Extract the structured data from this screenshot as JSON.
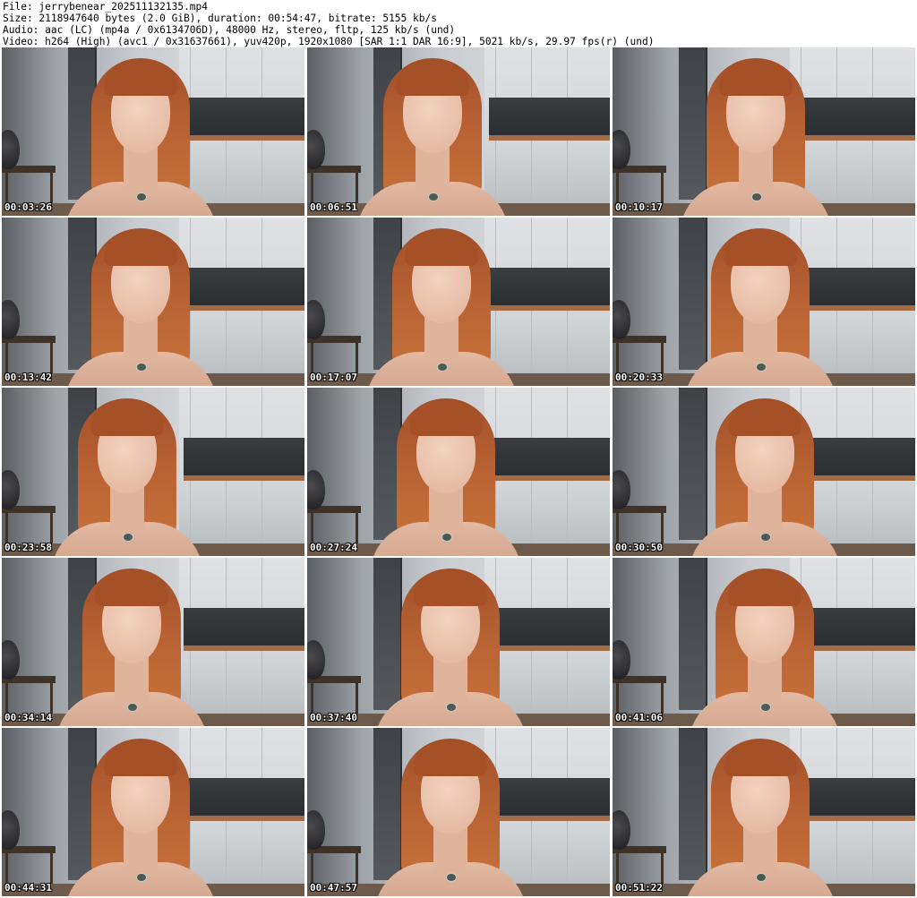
{
  "header": {
    "file_line": "File: jerrybenear_202511132135.mp4",
    "size_line": "Size: 2118947640 bytes (2.0 GiB), duration: 00:54:47, bitrate: 5155 kb/s",
    "audio_line": "Audio: aac (LC) (mp4a / 0x6134706D), 48000 Hz, stereo, fltp, 125 kb/s (und)",
    "video_line": "Video: h264 (High) (avc1 / 0x31637661), yuv420p, 1920x1080 [SAR 1:1 DAR 16:9], 5021 kb/s, 29.97 fps(r) (und)"
  },
  "thumbnails": [
    {
      "timestamp": "00:03:26"
    },
    {
      "timestamp": "00:06:51"
    },
    {
      "timestamp": "00:10:17"
    },
    {
      "timestamp": "00:13:42"
    },
    {
      "timestamp": "00:17:07"
    },
    {
      "timestamp": "00:20:33"
    },
    {
      "timestamp": "00:23:58"
    },
    {
      "timestamp": "00:27:24"
    },
    {
      "timestamp": "00:30:50"
    },
    {
      "timestamp": "00:34:14"
    },
    {
      "timestamp": "00:37:40"
    },
    {
      "timestamp": "00:41:06"
    },
    {
      "timestamp": "00:44:31"
    },
    {
      "timestamp": "00:47:57"
    },
    {
      "timestamp": "00:51:22"
    }
  ]
}
